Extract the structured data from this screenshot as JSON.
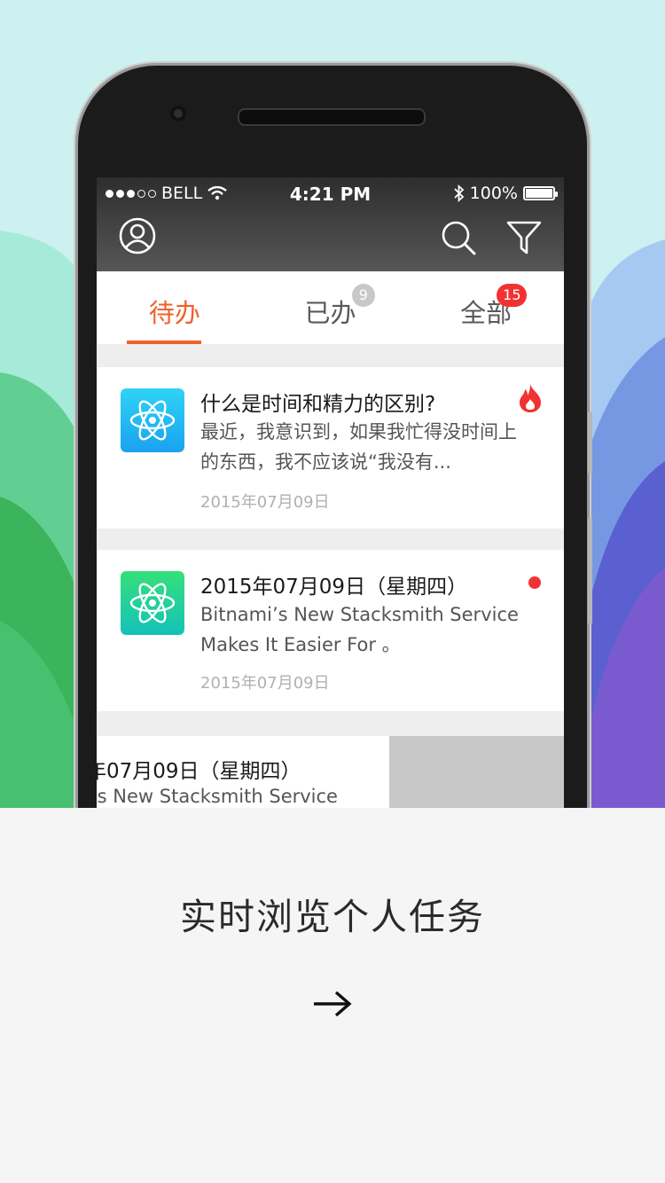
{
  "status_bar": {
    "carrier": "BELL",
    "time": "4:21 PM",
    "battery": "100%",
    "battery_level": 1.0,
    "signal_filled": 3,
    "signal_total": 5
  },
  "header": {
    "profile_icon": "user-circle-icon",
    "search_icon": "search-icon",
    "filter_icon": "filter-icon"
  },
  "tabs": [
    {
      "label": "待办",
      "active": true,
      "badge": ""
    },
    {
      "label": "已办",
      "active": false,
      "badge": "9"
    },
    {
      "label": "全部",
      "active": false,
      "badge": "15"
    }
  ],
  "cards": [
    {
      "title": "什么是时间和精力的区别?",
      "description": "最近，我意识到，如果我忙得没时间上的东西，我不应该说“我没有...",
      "date": "2015年07月09日",
      "icon": "atom-icon",
      "flag": "fire-icon"
    },
    {
      "title": "2015年07月09日（星期四）",
      "description": "Bitnami’s New Stacksmith Service Makes It Easier For 。",
      "date": "2015年07月09日",
      "icon": "atom-icon",
      "flag": "red-dot"
    },
    {
      "title": "年07月09日（星期四）",
      "description": "’s New Stacksmith Service"
    }
  ],
  "caption": "实时浏览个人任务",
  "next_icon": "arrow-right-icon",
  "colors": {
    "accent": "#f1602a",
    "badge_red": "#f23232",
    "badge_gray": "#c8c8c8"
  }
}
